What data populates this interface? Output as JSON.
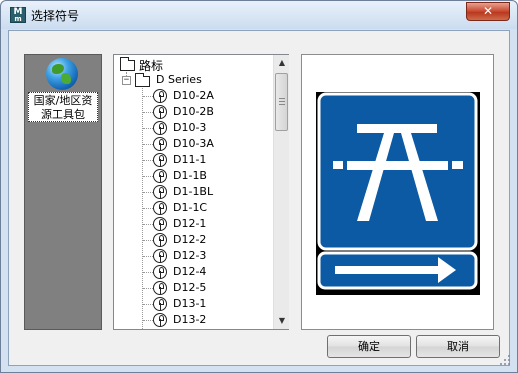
{
  "window": {
    "title": "选择符号",
    "app_icon_text": "M",
    "close_glyph": "✕"
  },
  "left_panel": {
    "items": [
      {
        "label": "国家/地区资源工具包",
        "icon": "globe-icon",
        "selected": true
      }
    ]
  },
  "tree": {
    "root": {
      "label": "路标",
      "icon": "folder-icon"
    },
    "category": {
      "label": "D Series",
      "icon": "folder-icon",
      "expander": "−"
    },
    "symbols": [
      "D10-2A",
      "D10-2B",
      "D10-3",
      "D10-3A",
      "D11-1",
      "D1-1B",
      "D1-1BL",
      "D1-1C",
      "D12-1",
      "D12-2",
      "D12-3",
      "D12-4",
      "D12-5",
      "D13-1",
      "D13-2"
    ],
    "scroll_up_glyph": "▲",
    "scroll_down_glyph": "▼"
  },
  "preview": {
    "sign_color": "#0b5aa3",
    "sign_border": "#ffffff",
    "arrow_icon": "arrow-right-icon",
    "main_icon": "picnic-table-icon"
  },
  "buttons": {
    "ok": "确定",
    "cancel": "取消"
  }
}
